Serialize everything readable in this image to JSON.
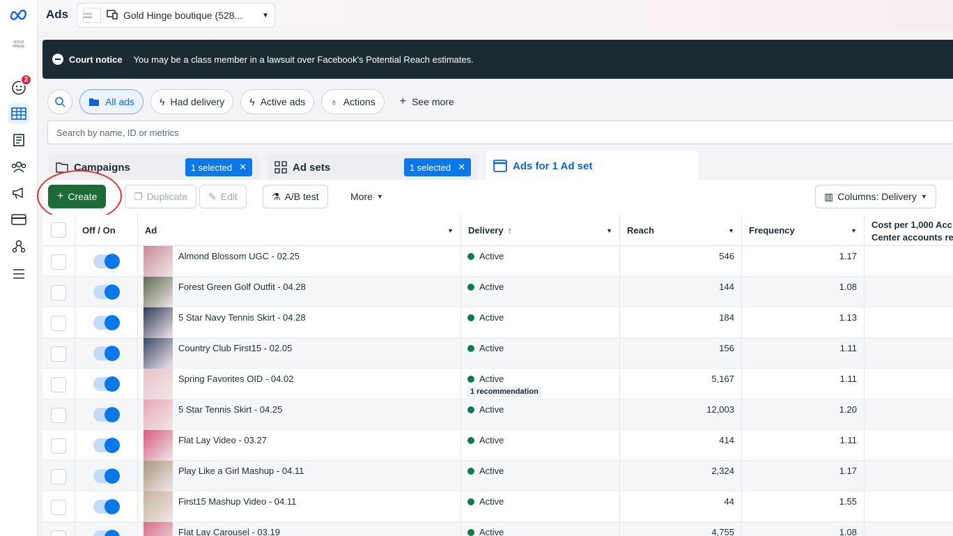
{
  "app": {
    "title": "Ads"
  },
  "account": {
    "name": "Gold Hinge boutique (528...",
    "logo_text": "GOLD HINGE"
  },
  "rail": {
    "notification_count": "2"
  },
  "notice": {
    "title": "Court notice",
    "text": "You may be a class member in a lawsuit over Facebook's Potential Reach estimates."
  },
  "filters": {
    "all_ads": "All ads",
    "had_delivery": "Had delivery",
    "active_ads": "Active ads",
    "actions": "Actions",
    "see_more": "See more"
  },
  "search": {
    "placeholder": "Search by name, ID or metrics"
  },
  "tabs": {
    "campaigns": "Campaigns",
    "campaigns_selected": "1 selected",
    "adsets": "Ad sets",
    "adsets_selected": "1 selected",
    "ads": "Ads for 1 Ad set"
  },
  "toolbar": {
    "create": "Create",
    "duplicate": "Duplicate",
    "edit": "Edit",
    "ab_test": "A/B test",
    "more": "More",
    "columns": "Columns: Delivery"
  },
  "table": {
    "headers": {
      "offon": "Off / On",
      "ad": "Ad",
      "delivery": "Delivery",
      "reach": "Reach",
      "frequency": "Frequency",
      "cost": "Cost per 1,000 Acc",
      "cost2": "Center accounts re"
    },
    "rows": [
      {
        "name": "Almond Blossom UGC - 02.25",
        "status": "Active",
        "reach": "546",
        "frequency": "1.17",
        "thumb": "#c98a9a"
      },
      {
        "name": "Forest Green Golf Outfit - 04.28",
        "status": "Active",
        "reach": "144",
        "frequency": "1.08",
        "thumb": "#5e6b52"
      },
      {
        "name": "5 Star Navy Tennis Skirt - 04.28",
        "status": "Active",
        "reach": "184",
        "frequency": "1.13",
        "thumb": "#2d3a5c"
      },
      {
        "name": "Country Club First15 - 02.05",
        "status": "Active",
        "reach": "156",
        "frequency": "1.11",
        "thumb": "#3b4a6b"
      },
      {
        "name": "Spring Favorites OID - 04.02",
        "status": "Active",
        "recommendation": "1 recommendation",
        "reach": "5,167",
        "frequency": "1.11",
        "thumb": "#e9c2cc"
      },
      {
        "name": "5 Star Tennis Skirt - 04.25",
        "status": "Active",
        "reach": "12,003",
        "frequency": "1.20",
        "thumb": "#e7a8b6"
      },
      {
        "name": "Flat Lay Video - 03.27",
        "status": "Active",
        "reach": "414",
        "frequency": "1.11",
        "thumb": "#d55c7d"
      },
      {
        "name": "Play Like a Girl Mashup - 04.11",
        "status": "Active",
        "reach": "2,324",
        "frequency": "1.17",
        "thumb": "#a8987d"
      },
      {
        "name": "First15 Mashup Video - 04.11",
        "status": "Active",
        "reach": "44",
        "frequency": "1.55",
        "thumb": "#c7b39a"
      },
      {
        "name": "Flat Lay Carousel - 03.19",
        "status": "Active",
        "reach": "4,755",
        "frequency": "1.08",
        "thumb": "#d46b86"
      }
    ]
  }
}
